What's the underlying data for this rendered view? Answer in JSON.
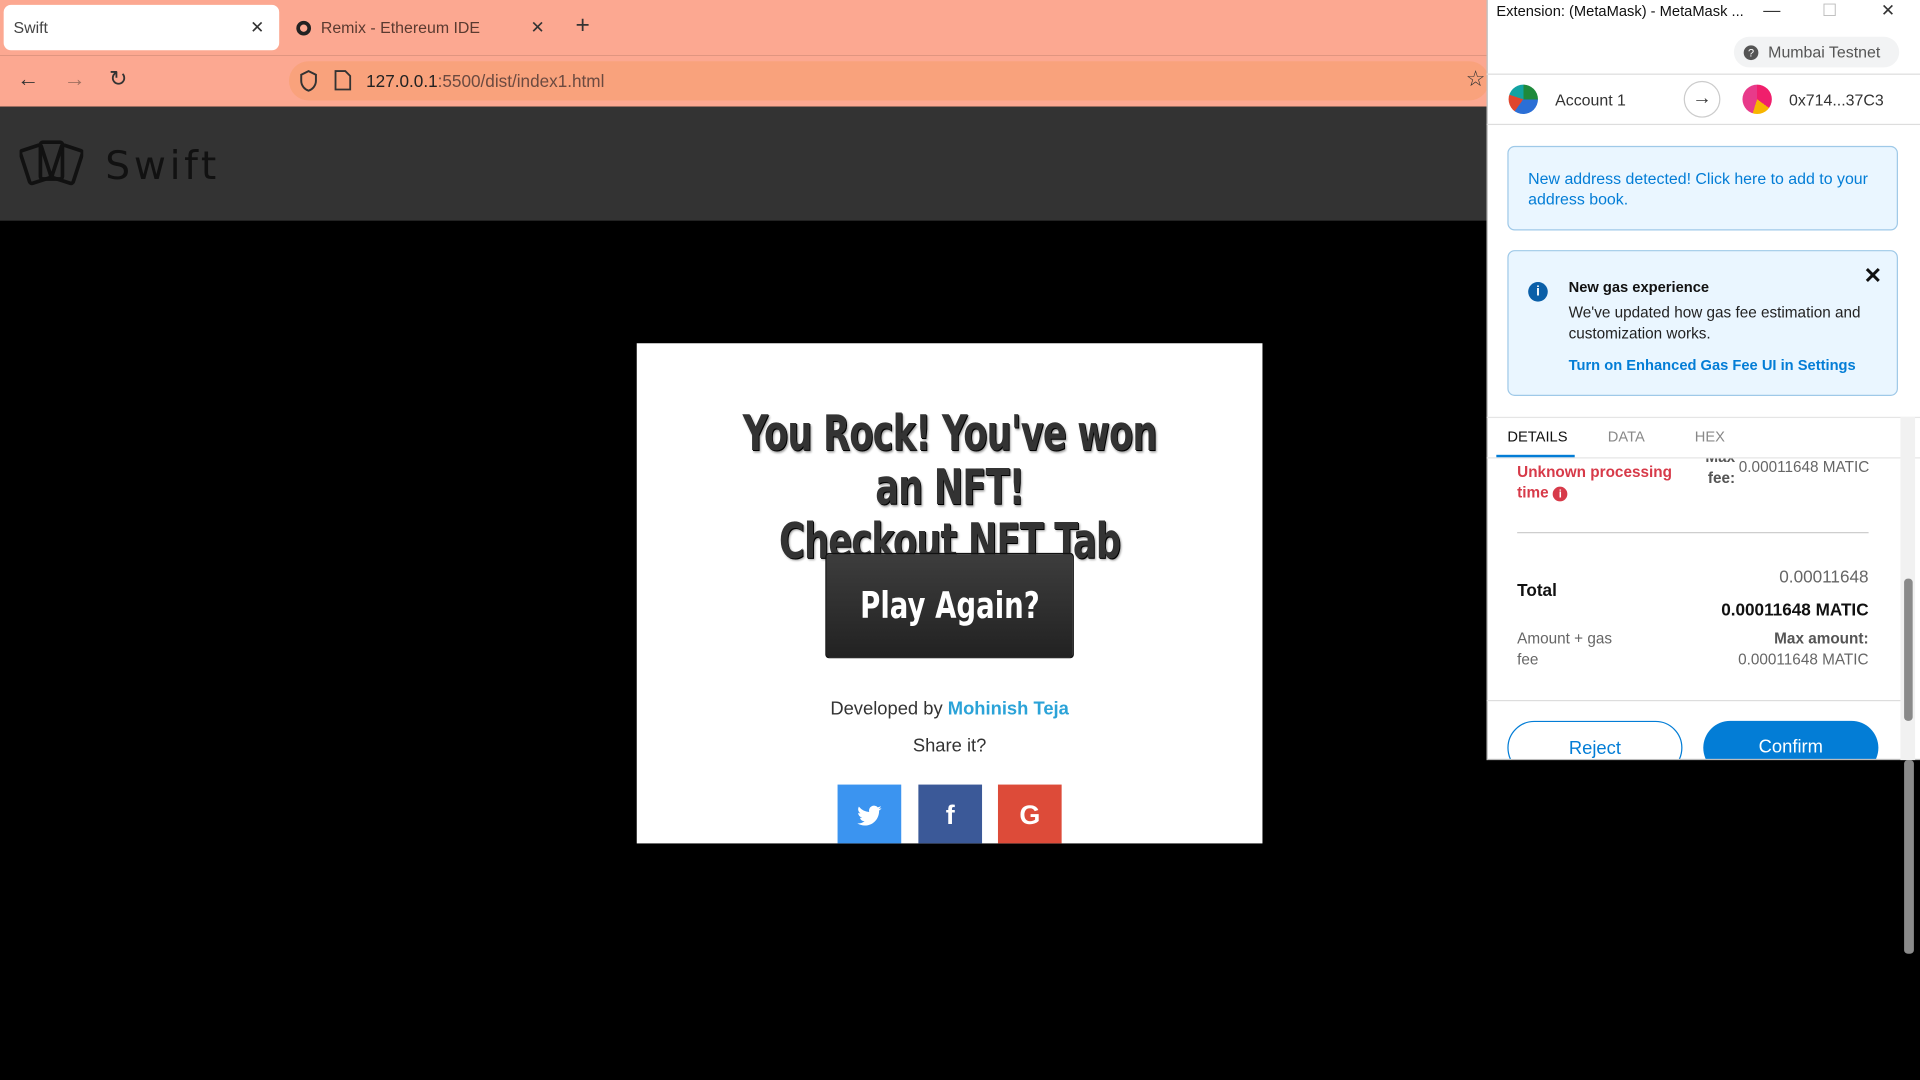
{
  "browser": {
    "tabs": [
      {
        "label": "Swift"
      },
      {
        "label": "Remix - Ethereum IDE"
      }
    ],
    "url_host": "127.0.0.1",
    "url_rest": ":5500/dist/index1.html"
  },
  "site": {
    "brand": "Swift"
  },
  "modal": {
    "headline_line1": "You Rock! You've won an NFT!",
    "headline_line2": "Checkout NFT Tab",
    "play_label": "Play Again?",
    "developed_by": "Developed by",
    "developer_name": "Mohinish Teja",
    "share": "Share it?"
  },
  "metamask": {
    "window_title": "Extension: (MetaMask) - MetaMask ...",
    "network": "Mumbai Testnet",
    "account_name": "Account 1",
    "to_address": "0x714...37C3",
    "address_notice": "New address detected! Click here to add to your address book.",
    "gas_title": "New gas experience",
    "gas_body": "We've updated how gas fee estimation and customization works.",
    "gas_link": "Turn on Enhanced Gas Fee UI in Settings",
    "tabs": [
      "DETAILS",
      "DATA",
      "HEX"
    ],
    "unknown_time_1": "Unknown processing",
    "unknown_time_2": "time",
    "max_fee_label_1": "Max",
    "max_fee_label_2": "fee:",
    "max_fee_value": "0.00011648 MATIC",
    "total_label": "Total",
    "total_small": "0.00011648",
    "total_bold": "0.00011648 MATIC",
    "amount_gas_1": "Amount + gas",
    "amount_gas_2": "fee",
    "max_amount_label": "Max amount:",
    "max_amount_value": "0.00011648 MATIC",
    "reject": "Reject",
    "confirm": "Confirm"
  },
  "colors": {
    "brand_accent": "#037dd6",
    "chrome": "#fca891",
    "error": "#d73a49",
    "twitter": "#3b94f0",
    "facebook": "#3b5998",
    "google": "#dd4b39"
  }
}
